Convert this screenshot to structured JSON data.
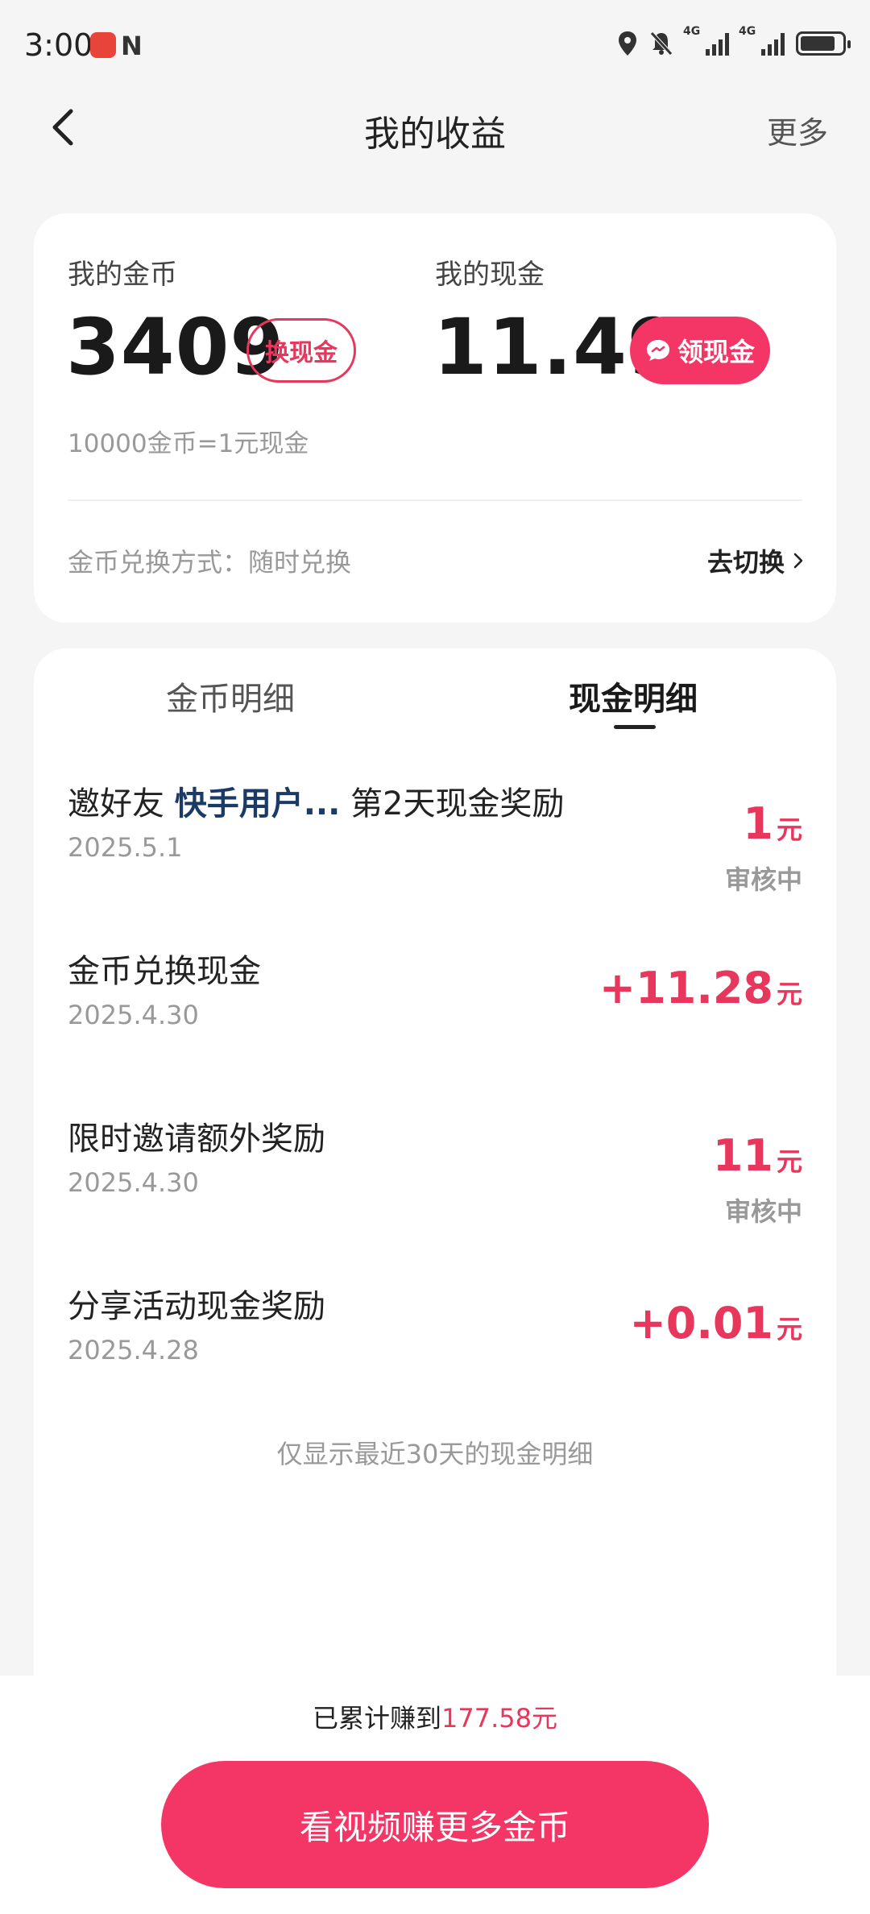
{
  "status_bar": {
    "time": "3:00",
    "nfc": "N",
    "net1": "4G",
    "net2": "4G"
  },
  "header": {
    "title": "我的收益",
    "more": "更多"
  },
  "summary": {
    "coins_label": "我的金币",
    "coins_value": "3409",
    "exchange_button": "换现金",
    "cash_label": "我的现金",
    "cash_value": "11.49",
    "withdraw_button": "领现金",
    "rate_text": "10000金币=1元现金",
    "method_text": "金币兑换方式：随时兑换",
    "switch_label": "去切换"
  },
  "tabs": [
    {
      "label": "金币明细",
      "active": false
    },
    {
      "label": "现金明细",
      "active": true
    }
  ],
  "records": [
    {
      "title_prefix": "邀好友 ",
      "title_highlight": "快手用户...",
      "title_suffix": " 第2天现金奖励",
      "date": "2025.5.1",
      "amount": "1",
      "unit": "元",
      "status": "审核中"
    },
    {
      "title": "金币兑换现金",
      "date": "2025.4.30",
      "amount": "+11.28",
      "unit": "元",
      "status": ""
    },
    {
      "title": "限时邀请额外奖励",
      "date": "2025.4.30",
      "amount": "11",
      "unit": "元",
      "status": "审核中"
    },
    {
      "title": "分享活动现金奖励",
      "date": "2025.4.28",
      "amount": "+0.01",
      "unit": "元",
      "status": ""
    }
  ],
  "footnote": "仅显示最近30天的现金明细",
  "bottom": {
    "earned_prefix": "已累计赚到",
    "earned_amount": "177.58元",
    "cta_label": "看视频赚更多金币"
  },
  "colors": {
    "accent": "#f33666",
    "highlight": "#1b3a66",
    "background": "#f5f5f5"
  }
}
